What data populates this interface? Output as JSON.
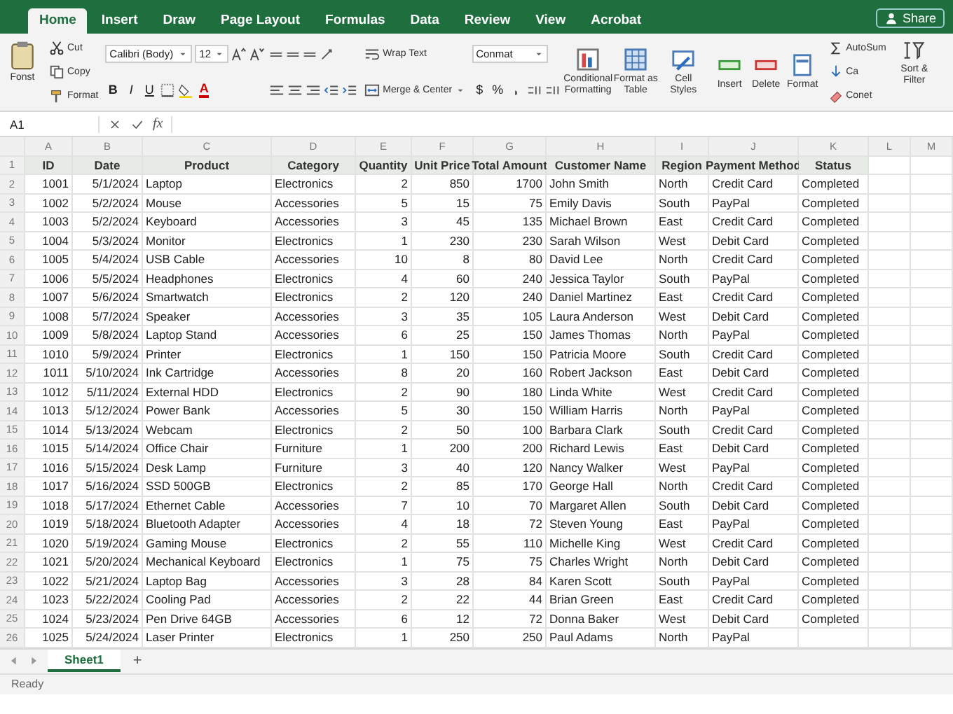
{
  "ribbon": {
    "tabs": [
      {
        "label": "Home",
        "selected": true
      },
      {
        "label": "Insert",
        "selected": false
      },
      {
        "label": "Draw",
        "selected": false
      },
      {
        "label": "Page Layout",
        "selected": false
      },
      {
        "label": "Formulas",
        "selected": false
      },
      {
        "label": "Data",
        "selected": false
      },
      {
        "label": "Review",
        "selected": false
      },
      {
        "label": "View",
        "selected": false
      },
      {
        "label": "Acrobat",
        "selected": false
      }
    ],
    "share": "Share",
    "clipboard": {
      "paste": "Fonst",
      "cut": "Cut",
      "copy": "Copy",
      "format": "Format"
    },
    "font": {
      "name": "Calibri (Body)",
      "size": "12",
      "bold": "B",
      "italic": "I",
      "underline": "U",
      "font_color_button": "A"
    },
    "alignment": {
      "wrap": "Wrap Text",
      "merge": "Merge & Center"
    },
    "number": {
      "format": "Conmat",
      "currency": "$",
      "percent": "%"
    },
    "styles": [
      "Conditional Formatting",
      "Format as Table",
      "Cell Styles"
    ],
    "cells": [
      "Insert",
      "Delete",
      "Format"
    ],
    "editing": [
      "AutoSum",
      "Ca",
      "Conet"
    ],
    "sort": "Sort & Filter"
  },
  "formula_bar": {
    "name_box": "A1",
    "fx": "fx"
  },
  "column_letters": [
    "A",
    "B",
    "C",
    "D",
    "E",
    "F",
    "G",
    "H",
    "I",
    "J",
    "K",
    "L",
    "M"
  ],
  "table": {
    "header_row": "1",
    "columns": [
      {
        "header": "ID",
        "kind": "number"
      },
      {
        "header": "Date",
        "kind": "number"
      },
      {
        "header": "Product",
        "kind": "text"
      },
      {
        "header": "Category",
        "kind": "text"
      },
      {
        "header": "Quantity",
        "kind": "number"
      },
      {
        "header": "Unit Price",
        "kind": "number"
      },
      {
        "header": "Total Amount",
        "kind": "number"
      },
      {
        "header": "Customer Name",
        "kind": "text"
      },
      {
        "header": "Region",
        "kind": "text"
      },
      {
        "header": "Payment Method",
        "kind": "text"
      },
      {
        "header": "Status",
        "kind": "text"
      }
    ],
    "rows": [
      {
        "number": "2",
        "cells": [
          "1001",
          "5/1/2024",
          "Laptop",
          "Electronics",
          "2",
          "850",
          "1700",
          "John Smith",
          "North",
          "Credit Card",
          "Completed"
        ]
      },
      {
        "number": "3",
        "cells": [
          "1002",
          "5/2/2024",
          "Mouse",
          "Accessories",
          "5",
          "15",
          "75",
          "Emily Davis",
          "South",
          "PayPal",
          "Completed"
        ]
      },
      {
        "number": "4",
        "cells": [
          "1003",
          "5/2/2024",
          "Keyboard",
          "Accessories",
          "3",
          "45",
          "135",
          "Michael Brown",
          "East",
          "Credit Card",
          "Completed"
        ]
      },
      {
        "number": "5",
        "cells": [
          "1004",
          "5/3/2024",
          "Monitor",
          "Electronics",
          "1",
          "230",
          "230",
          "Sarah Wilson",
          "West",
          "Debit Card",
          "Completed"
        ]
      },
      {
        "number": "6",
        "cells": [
          "1005",
          "5/4/2024",
          "USB Cable",
          "Accessories",
          "10",
          "8",
          "80",
          "David Lee",
          "North",
          "Credit Card",
          "Completed"
        ]
      },
      {
        "number": "7",
        "cells": [
          "1006",
          "5/5/2024",
          "Headphones",
          "Electronics",
          "4",
          "60",
          "240",
          "Jessica Taylor",
          "South",
          "PayPal",
          "Completed"
        ]
      },
      {
        "number": "8",
        "cells": [
          "1007",
          "5/6/2024",
          "Smartwatch",
          "Electronics",
          "2",
          "120",
          "240",
          "Daniel Martinez",
          "East",
          "Credit Card",
          "Completed"
        ]
      },
      {
        "number": "9",
        "cells": [
          "1008",
          "5/7/2024",
          "Speaker",
          "Accessories",
          "3",
          "35",
          "105",
          "Laura Anderson",
          "West",
          "Debit Card",
          "Completed"
        ]
      },
      {
        "number": "10",
        "cells": [
          "1009",
          "5/8/2024",
          "Laptop Stand",
          "Accessories",
          "6",
          "25",
          "150",
          "James Thomas",
          "North",
          "PayPal",
          "Completed"
        ]
      },
      {
        "number": "11",
        "cells": [
          "1010",
          "5/9/2024",
          "Printer",
          "Electronics",
          "1",
          "150",
          "150",
          "Patricia Moore",
          "South",
          "Credit Card",
          "Completed"
        ]
      },
      {
        "number": "12",
        "cells": [
          "1011",
          "5/10/2024",
          "Ink Cartridge",
          "Accessories",
          "8",
          "20",
          "160",
          "Robert Jackson",
          "East",
          "Debit Card",
          "Completed"
        ]
      },
      {
        "number": "13",
        "cells": [
          "1012",
          "5/11/2024",
          "External HDD",
          "Electronics",
          "2",
          "90",
          "180",
          "Linda White",
          "West",
          "Credit Card",
          "Completed"
        ]
      },
      {
        "number": "14",
        "cells": [
          "1013",
          "5/12/2024",
          "Power Bank",
          "Accessories",
          "5",
          "30",
          "150",
          "William Harris",
          "North",
          "PayPal",
          "Completed"
        ]
      },
      {
        "number": "15",
        "cells": [
          "1014",
          "5/13/2024",
          "Webcam",
          "Electronics",
          "2",
          "50",
          "100",
          "Barbara Clark",
          "South",
          "Credit Card",
          "Completed"
        ]
      },
      {
        "number": "16",
        "cells": [
          "1015",
          "5/14/2024",
          "Office Chair",
          "Furniture",
          "1",
          "200",
          "200",
          "Richard Lewis",
          "East",
          "Debit Card",
          "Completed"
        ]
      },
      {
        "number": "17",
        "cells": [
          "1016",
          "5/15/2024",
          "Desk Lamp",
          "Furniture",
          "3",
          "40",
          "120",
          "Nancy Walker",
          "West",
          "PayPal",
          "Completed"
        ]
      },
      {
        "number": "18",
        "cells": [
          "1017",
          "5/16/2024",
          "SSD 500GB",
          "Electronics",
          "2",
          "85",
          "170",
          "George Hall",
          "North",
          "Credit Card",
          "Completed"
        ]
      },
      {
        "number": "19",
        "cells": [
          "1018",
          "5/17/2024",
          "Ethernet Cable",
          "Accessories",
          "7",
          "10",
          "70",
          "Margaret Allen",
          "South",
          "Debit Card",
          "Completed"
        ]
      },
      {
        "number": "20",
        "cells": [
          "1019",
          "5/18/2024",
          "Bluetooth Adapter",
          "Accessories",
          "4",
          "18",
          "72",
          "Steven Young",
          "East",
          "PayPal",
          "Completed"
        ]
      },
      {
        "number": "21",
        "cells": [
          "1020",
          "5/19/2024",
          "Gaming Mouse",
          "Electronics",
          "2",
          "55",
          "110",
          "Michelle King",
          "West",
          "Credit Card",
          "Completed"
        ]
      },
      {
        "number": "22",
        "cells": [
          "1021",
          "5/20/2024",
          "Mechanical Keyboard",
          "Electronics",
          "1",
          "75",
          "75",
          "Charles Wright",
          "North",
          "Debit Card",
          "Completed"
        ]
      },
      {
        "number": "23",
        "cells": [
          "1022",
          "5/21/2024",
          "Laptop Bag",
          "Accessories",
          "3",
          "28",
          "84",
          "Karen Scott",
          "South",
          "PayPal",
          "Completed"
        ]
      },
      {
        "number": "24",
        "cells": [
          "1023",
          "5/22/2024",
          "Cooling Pad",
          "Accessories",
          "2",
          "22",
          "44",
          "Brian Green",
          "East",
          "Credit Card",
          "Completed"
        ]
      },
      {
        "number": "25",
        "cells": [
          "1024",
          "5/23/2024",
          "Pen Drive 64GB",
          "Accessories",
          "6",
          "12",
          "72",
          "Donna Baker",
          "West",
          "Debit Card",
          "Completed"
        ]
      },
      {
        "number": "26",
        "cells": [
          "1025",
          "5/24/2024",
          "Laser Printer",
          "Electronics",
          "1",
          "250",
          "250",
          "Paul Adams",
          "North",
          "PayPal"
        ]
      }
    ]
  },
  "sheet_tabs": [
    {
      "label": "Sheet1",
      "selected": true
    }
  ],
  "add_sheet": "+",
  "status_bar": "Ready"
}
